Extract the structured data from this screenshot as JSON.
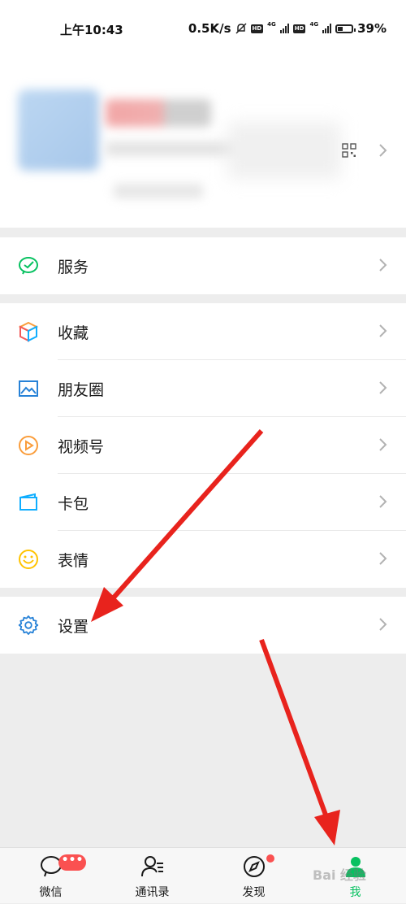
{
  "status_bar": {
    "time": "上午10:43",
    "speed": "0.5K/s",
    "net1": "4G",
    "net2": "4G",
    "hd": "HD",
    "battery": "39%"
  },
  "menu": {
    "service": "服务",
    "favorites": "收藏",
    "moments": "朋友圈",
    "channels": "视频号",
    "cards": "卡包",
    "stickers": "表情",
    "settings": "设置"
  },
  "tabs": [
    {
      "label": "微信",
      "badge": "•••"
    },
    {
      "label": "通讯录"
    },
    {
      "label": "发现"
    },
    {
      "label": "我",
      "active": true
    }
  ],
  "colors": {
    "accent": "#07c160",
    "badge": "#fa5151",
    "arrow": "#e8231d"
  },
  "watermark": "Bai 经验"
}
